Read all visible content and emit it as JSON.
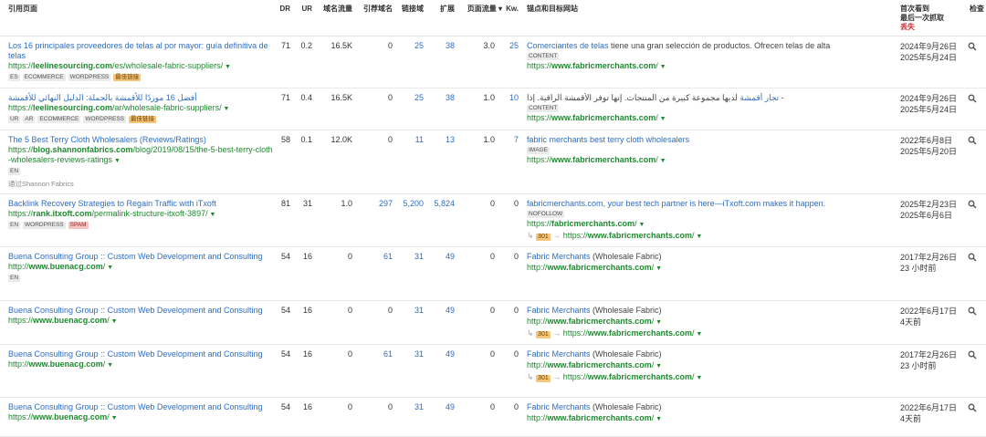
{
  "headers": {
    "ref_page": "引用页面",
    "dr": "DR",
    "ur": "UR",
    "domain_traffic": "域名流量",
    "ref_domains": "引荐域名",
    "linked_domains": "链接域",
    "ext": "扩展",
    "page_traffic": "页面流量 ▾",
    "kw": "Kw.",
    "anchor_target": "锚点和目标网站",
    "first_seen_1": "首次看到",
    "first_seen_2": "最后一次抓取",
    "first_seen_3": "丢失",
    "inspect": "检查"
  },
  "rows": [
    {
      "title": "Los 16 principales proveedores de telas al por mayor: guía definitiva de telas",
      "url_pre": "https://",
      "url_bold": "leelinesourcing.com",
      "url_post": "/es/wholesale-fabric-suppliers/",
      "tags": [
        {
          "t": "ES",
          "k": ""
        },
        {
          "t": "ECOMMERCE",
          "k": ""
        },
        {
          "t": "WORDPRESS",
          "k": ""
        },
        {
          "t": "最佳链接",
          "k": "orange"
        }
      ],
      "via": "",
      "dr": "71",
      "ur": "0.2",
      "domain_traffic": "16.5K",
      "ref_domains": "0",
      "linked_domains": "25",
      "ext": "38",
      "page_traffic": "3.0",
      "kw": "25",
      "anchor_link": "Comerciantes de telas",
      "anchor_rest": " tiene una gran selección de productos. Ofrecen telas de alta",
      "anchor_tag": "CONTENT",
      "target_pre": "https://",
      "target_bold": "www.fabricmerchants.com",
      "target_post": "/",
      "redirect_code": "",
      "redirect_pre": "",
      "redirect_bold": "",
      "redirect_post": "",
      "date1": "2024年9月26日",
      "date2": "2025年5月24日"
    },
    {
      "title": "أفضل 16 موردًا للأقمشة بالجملة: الدليل النهائي للأقمشة",
      "url_pre": "https://",
      "url_bold": "leelinesourcing.com",
      "url_post": "/ar/wholesale-fabric-suppliers/",
      "tags": [
        {
          "t": "UR",
          "k": ""
        },
        {
          "t": "AR",
          "k": ""
        },
        {
          "t": "ECOMMERCE",
          "k": ""
        },
        {
          "t": "WORDPRESS",
          "k": ""
        },
        {
          "t": "最佳链接",
          "k": "orange"
        }
      ],
      "via": "",
      "dr": "71",
      "ur": "0.4",
      "domain_traffic": "16.5K",
      "ref_domains": "0",
      "linked_domains": "25",
      "ext": "38",
      "page_traffic": "1.0",
      "kw": "10",
      "anchor_link": "تجار أقمشة",
      "anchor_rest": " لديها مجموعة كبيرة من المنتجات. إنها توفر الأقمشة الراقية. إذا -",
      "anchor_tag": "CONTENT",
      "target_pre": "https://",
      "target_bold": "www.fabricmerchants.com",
      "target_post": "/",
      "redirect_code": "",
      "redirect_pre": "",
      "redirect_bold": "",
      "redirect_post": "",
      "date1": "2024年9月26日",
      "date2": "2025年5月24日"
    },
    {
      "title": "The 5 Best Terry Cloth Wholesalers (Reviews/Ratings)",
      "url_pre": "https://",
      "url_bold": "blog.shannonfabrics.com",
      "url_post": "/blog/2019/08/15/the-5-best-terry-cloth-wholesalers-reviews-ratings",
      "tags": [
        {
          "t": "EN",
          "k": ""
        }
      ],
      "via": "通过Shannon Fabrics",
      "dr": "58",
      "ur": "0.1",
      "domain_traffic": "12.0K",
      "ref_domains": "0",
      "linked_domains": "11",
      "ext": "13",
      "page_traffic": "1.0",
      "kw": "7",
      "anchor_link": "fabric merchants best terry cloth wholesalers",
      "anchor_rest": "",
      "anchor_tag": "IMAGE",
      "target_pre": "https://",
      "target_bold": "www.fabricmerchants.com",
      "target_post": "/",
      "redirect_code": "",
      "redirect_pre": "",
      "redirect_bold": "",
      "redirect_post": "",
      "date1": "2022年6月8日",
      "date2": "2025年5月20日"
    },
    {
      "title": "Backlink Recovery Strategies to Regain Traffic with iTxoft",
      "url_pre": "https://",
      "url_bold": "rank.itxoft.com",
      "url_post": "/permalink-structure-itxoft-3897/",
      "tags": [
        {
          "t": "EN",
          "k": ""
        },
        {
          "t": "WORDPRESS",
          "k": ""
        },
        {
          "t": "SPAM",
          "k": "red"
        }
      ],
      "via": "",
      "dr": "81",
      "ur": "31",
      "domain_traffic": "1.0",
      "ref_domains": "297",
      "linked_domains": "5,200",
      "ext": "5,824",
      "page_traffic": "0",
      "kw": "0",
      "anchor_link": "fabricmerchants.com, your best tech partner is here—iTxoft.com makes it happen.",
      "anchor_rest": "",
      "anchor_tag": "NOFOLLOW",
      "target_pre": "https://",
      "target_bold": "fabricmerchants.com",
      "target_post": "/",
      "redirect_code": "301",
      "redirect_pre": "https://",
      "redirect_bold": "www.fabricmerchants.com",
      "redirect_post": "/",
      "date1": "2025年2月23日",
      "date2": "2025年6月6日"
    },
    {
      "title": "Buena Consulting Group :: Custom Web Development and Consulting",
      "url_pre": "http://",
      "url_bold": "www.buenacg.com",
      "url_post": "/",
      "tags": [
        {
          "t": "EN",
          "k": ""
        }
      ],
      "via": "",
      "dr": "54",
      "ur": "16",
      "domain_traffic": "0",
      "ref_domains": "61",
      "linked_domains": "31",
      "ext": "49",
      "page_traffic": "0",
      "kw": "0",
      "anchor_link": "Fabric Merchants",
      "anchor_rest": " (Wholesale Fabric)",
      "anchor_tag": "",
      "target_pre": "http://",
      "target_bold": "www.fabricmerchants.com",
      "target_post": "/",
      "redirect_code": "",
      "redirect_pre": "",
      "redirect_bold": "",
      "redirect_post": "",
      "date1": "2017年2月26日",
      "date2": "23 小时前"
    },
    {
      "title": "Buena Consulting Group :: Custom Web Development and Consulting",
      "url_pre": "https://",
      "url_bold": "www.buenacg.com",
      "url_post": "/",
      "tags": [],
      "via": "",
      "dr": "54",
      "ur": "16",
      "domain_traffic": "0",
      "ref_domains": "0",
      "linked_domains": "31",
      "ext": "49",
      "page_traffic": "0",
      "kw": "0",
      "anchor_link": "Fabric Merchants",
      "anchor_rest": " (Wholesale Fabric)",
      "anchor_tag": "",
      "target_pre": "http://",
      "target_bold": "www.fabricmerchants.com",
      "target_post": "/",
      "redirect_code": "301",
      "redirect_pre": "https://",
      "redirect_bold": "www.fabricmerchants.com",
      "redirect_post": "/",
      "date1": "2022年6月17日",
      "date2": "4天前"
    },
    {
      "title": "Buena Consulting Group :: Custom Web Development and Consulting",
      "url_pre": "http://",
      "url_bold": "www.buenacg.com",
      "url_post": "/",
      "tags": [],
      "via": "",
      "dr": "54",
      "ur": "16",
      "domain_traffic": "0",
      "ref_domains": "61",
      "linked_domains": "31",
      "ext": "49",
      "page_traffic": "0",
      "kw": "0",
      "anchor_link": "Fabric Merchants",
      "anchor_rest": " (Wholesale Fabric)",
      "anchor_tag": "",
      "target_pre": "http://",
      "target_bold": "www.fabricmerchants.com",
      "target_post": "/",
      "redirect_code": "301",
      "redirect_pre": "https://",
      "redirect_bold": "www.fabricmerchants.com",
      "redirect_post": "/",
      "date1": "2017年2月26日",
      "date2": "23 小时前"
    },
    {
      "title": "Buena Consulting Group :: Custom Web Development and Consulting",
      "url_pre": "https://",
      "url_bold": "www.buenacg.com",
      "url_post": "/",
      "tags": [],
      "via": "",
      "dr": "54",
      "ur": "16",
      "domain_traffic": "0",
      "ref_domains": "0",
      "linked_domains": "31",
      "ext": "49",
      "page_traffic": "0",
      "kw": "0",
      "anchor_link": "Fabric Merchants",
      "anchor_rest": " (Wholesale Fabric)",
      "anchor_tag": "",
      "target_pre": "http://",
      "target_bold": "www.fabricmerchants.com",
      "target_post": "/",
      "redirect_code": "",
      "redirect_pre": "",
      "redirect_bold": "",
      "redirect_post": "",
      "date1": "2022年6月17日",
      "date2": "4天前"
    }
  ]
}
